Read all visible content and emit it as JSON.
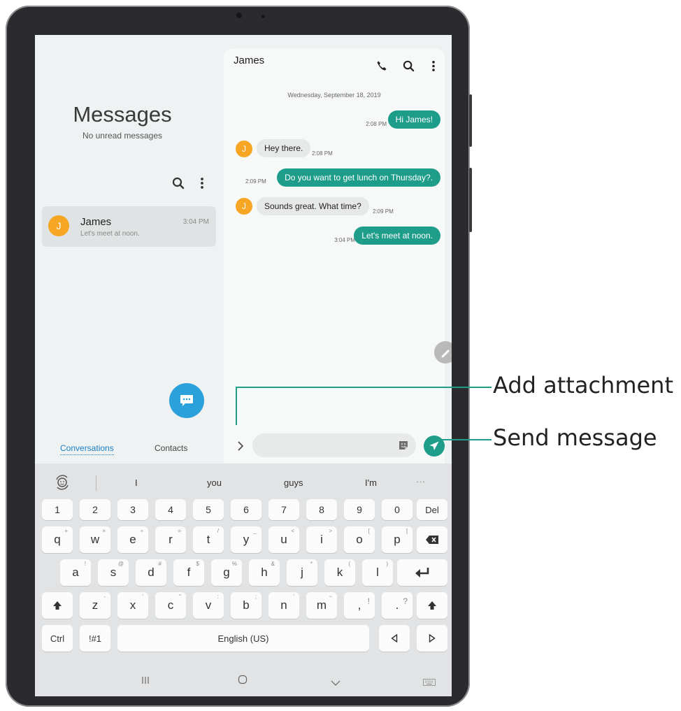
{
  "left_pane": {
    "title": "Messages",
    "subtitle": "No unread messages",
    "conversation": {
      "avatar_initial": "J",
      "name": "James",
      "preview": "Let's meet at noon.",
      "time": "3:04 PM"
    },
    "tabs": [
      {
        "label": "Conversations",
        "active": true
      },
      {
        "label": "Contacts",
        "active": false
      }
    ]
  },
  "chat": {
    "contact_name": "James",
    "date_header": "Wednesday, September 18, 2019",
    "messages": [
      {
        "direction": "out",
        "text": "Hi James!",
        "time": "2:08 PM"
      },
      {
        "direction": "in",
        "avatar_initial": "J",
        "text": "Hey there.",
        "time": "2:08 PM"
      },
      {
        "direction": "out",
        "text": "Do you want to get lunch on Thursday?.",
        "time": "2:09 PM"
      },
      {
        "direction": "in",
        "avatar_initial": "J",
        "text": "Sounds great. What time?",
        "time": "2:09 PM"
      },
      {
        "direction": "out",
        "text": "Let's meet at noon.",
        "time": "3:04 PM"
      }
    ]
  },
  "keyboard": {
    "suggestions": [
      "I",
      "you",
      "guys",
      "I'm",
      "···"
    ],
    "number_row": [
      "1",
      "2",
      "3",
      "4",
      "5",
      "6",
      "7",
      "8",
      "9",
      "0"
    ],
    "del_label": "Del",
    "row1": [
      "q",
      "w",
      "e",
      "r",
      "t",
      "y",
      "u",
      "i",
      "o",
      "p"
    ],
    "row1_hints": [
      "+",
      "×",
      "÷",
      "=",
      "/",
      "_",
      "<",
      ">",
      "[",
      "]"
    ],
    "row2": [
      "a",
      "s",
      "d",
      "f",
      "g",
      "h",
      "j",
      "k",
      "l"
    ],
    "row2_hints": [
      "!",
      "@",
      "#",
      "$",
      "%",
      "&",
      "*",
      "(",
      ")"
    ],
    "row3": [
      "z",
      "x",
      "c",
      "v",
      "b",
      "n",
      "m"
    ],
    "row3_hints": [
      "-",
      "'",
      "\"",
      ":",
      ";",
      "'",
      "~"
    ],
    "row3_punct": [
      ",",
      "."
    ],
    "row3_punct_hints": [
      "!",
      "?"
    ],
    "ctrl_label": "Ctrl",
    "symbols_label": "!#1",
    "space_label": "English (US)"
  },
  "callouts": {
    "add_attachment": "Add attachment",
    "send_message": "Send message"
  },
  "colors": {
    "accent": "#1f9d8b",
    "fab": "#2aa1da",
    "avatar": "#f6a623",
    "tab_active": "#1a7fc4"
  }
}
